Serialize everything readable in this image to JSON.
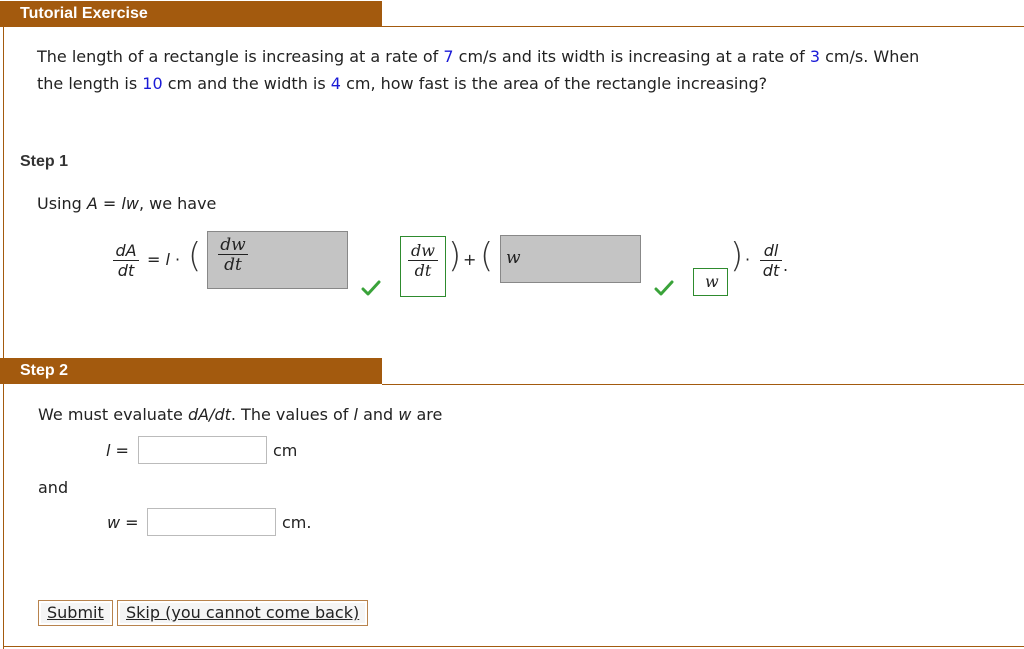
{
  "tutorial": {
    "header": "Tutorial Exercise",
    "problem": {
      "p1": "The length of a rectangle is increasing at a rate of ",
      "rate_l": "7",
      "p2": " cm/s and its width is increasing at a rate of ",
      "rate_w": "3",
      "p3": " cm/s. When",
      "p4": "the length is ",
      "length": "10",
      "p5": " cm and the width is ",
      "width": "4",
      "p6": " cm, how fast is the area of the rectangle increasing?"
    }
  },
  "step1": {
    "label": "Step 1",
    "intro_a": "Using ",
    "A": "A",
    "eq": " = ",
    "lw": "lw",
    "intro_b": ", we have",
    "lhs_num": "dA",
    "lhs_den": "dt",
    "eq2": "= ",
    "l": "l",
    "dot": " · ",
    "box1_num": "dw",
    "box1_den": "dt",
    "ans1_num": "dw",
    "ans1_den": "dt",
    "plus": "+",
    "box2_value": "w",
    "ans2": "w",
    "dot2": "·",
    "rhs_num": "dl",
    "rhs_den": "dt",
    "period": "."
  },
  "step2": {
    "label": "Step 2",
    "text_a": "We must evaluate ",
    "dAdt": "dA/dt",
    "text_b": ". The values of ",
    "l": "l",
    "text_c": " and ",
    "w": "w",
    "text_d": " are",
    "l_label": "l =",
    "l_value": "",
    "l_unit": "cm",
    "and": "and",
    "w_label": "w =",
    "w_value": "",
    "w_unit": "cm."
  },
  "buttons": {
    "submit": "Submit",
    "skip": "Skip (you cannot come back)"
  },
  "colors": {
    "accent": "#a35a0e",
    "correct": "#2e8b2e",
    "value_blue": "#1a1ad6"
  }
}
